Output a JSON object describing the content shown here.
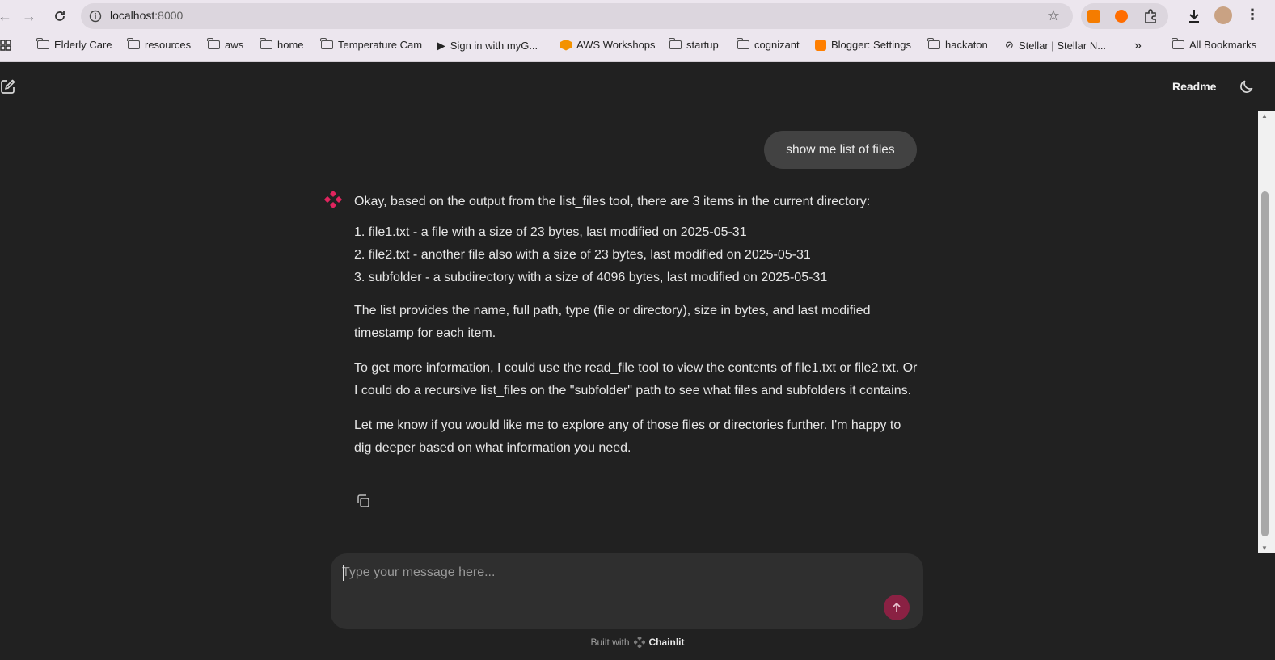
{
  "browser": {
    "url_host": "localhost",
    "url_port": ":8000",
    "bookmarks": [
      "Elderly Care",
      "resources",
      "aws",
      "home",
      "Temperature Cam",
      "Sign in with myG...",
      "AWS Workshops",
      "startup",
      "cognizant",
      "Blogger: Settings",
      "hackaton",
      "Stellar | Stellar N...",
      "All Bookmarks"
    ],
    "more_label": "»"
  },
  "header": {
    "readme_label": "Readme"
  },
  "chat": {
    "user_message": "show me list of files",
    "assistant": {
      "intro": "Okay, based on the output from the list_files tool, there are 3 items in the current directory:",
      "items": [
        "1. file1.txt - a file with a size of 23 bytes, last modified on 2025-05-31",
        "2. file2.txt - another file also with a size of 23 bytes, last modified on 2025-05-31",
        "3. subfolder - a subdirectory with a size of 4096 bytes, last modified on 2025-05-31"
      ],
      "para1": "The list provides the name, full path, type (file or directory), size in bytes, and last modified timestamp for each item.",
      "para2": "To get more information, I could use the read_file tool to view the contents of file1.txt or file2.txt. Or I could do a recursive list_files on the \"subfolder\" path to see what files and subfolders it contains.",
      "para3": "Let me know if you would like me to explore any of those files or directories further. I'm happy to dig deeper based on what information you need."
    }
  },
  "composer": {
    "placeholder": "Type your message here..."
  },
  "footer": {
    "built_with": "Built with",
    "brand": "Chainlit"
  },
  "colors": {
    "accent": "#e0245e",
    "send_button": "#8a2143",
    "background": "#212121"
  }
}
